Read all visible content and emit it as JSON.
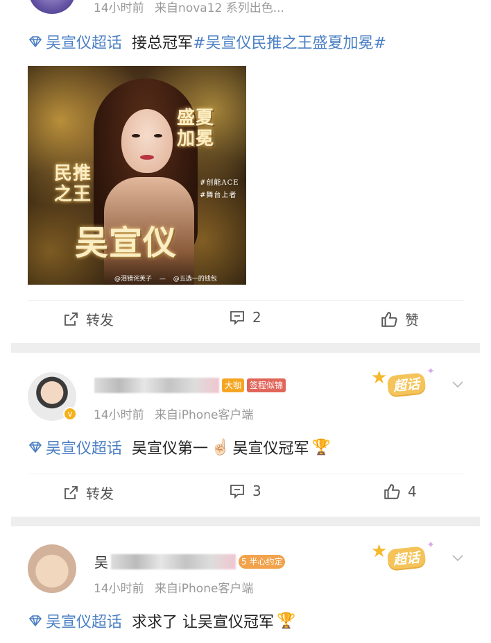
{
  "post1": {
    "meta_time": "14小时前",
    "meta_source": "来自",
    "meta_device": "nova12 系列出色...",
    "topic": "吴宣仪超话",
    "text": "接总冠军",
    "hashtag": "#吴宣仪民推之王盛夏加冕#",
    "poster": {
      "name_text": "吴宣仪",
      "king_text": "民推之王",
      "summer_text": "盛夏加冕",
      "small_text_1": "#创能ACE",
      "small_text_2": "#舞台上者",
      "credit_1": "@泪错诧芙子",
      "credit_2": "@五选一的钱包"
    },
    "actions": {
      "repost": "转发",
      "comments": "2",
      "likes": "赞"
    }
  },
  "post2": {
    "username_visible": "",
    "badge_1": "大咖",
    "badge_2": "签程似锦",
    "meta_time": "14小时前",
    "meta_source": "来自",
    "meta_device": "iPhone客户端",
    "topic": "吴宣仪超话",
    "text_1": "吴宣仪第一",
    "text_2": "吴宣仪冠军",
    "chaohua_label": "超话",
    "actions": {
      "repost": "转发",
      "comments": "3",
      "likes": "4"
    }
  },
  "post3": {
    "username_visible": "吴",
    "badge_level": "5",
    "badge_1": "半心约定",
    "meta_time": "14小时前",
    "meta_source": "来自",
    "meta_device": "iPhone客户端",
    "topic": "吴宣仪超话",
    "text": "求求了 让吴宣仪冠军",
    "chaohua_label": "超话"
  },
  "icons": {
    "pointing_emoji": "☝🏻",
    "trophy_emoji": "🏆"
  },
  "colors": {
    "link": "#4a7fc4",
    "divider": "#eeeeee",
    "meta": "#999999"
  }
}
